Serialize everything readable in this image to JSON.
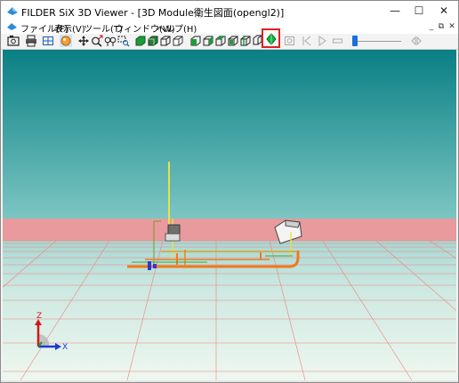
{
  "window": {
    "title": "FILDER SiX 3D Viewer - [3D Module衛生図面(opengl2)]",
    "controls": {
      "minimize": "—",
      "maximize": "☐",
      "close": "✕"
    }
  },
  "menu": {
    "items": [
      {
        "label": "ファイル(F)"
      },
      {
        "label": "表示(V)"
      },
      {
        "label": "ツール(T)"
      },
      {
        "label": "ウィンドウ(W)"
      },
      {
        "label": "ヘルプ(H)"
      }
    ],
    "mdi_controls": {
      "minimize": "_",
      "restore": "⧉",
      "close": "✕"
    }
  },
  "toolbar": {
    "icons": [
      "camera-icon",
      "print-icon",
      "grid-icon",
      "sphere-icon",
      "pan-icon",
      "zoom-in-icon",
      "zoom-out-icon",
      "zoom-window-icon",
      "solid-view-icon",
      "shaded-view-icon",
      "wire-view-icon",
      "hidden-view-icon",
      "front-view-icon",
      "side-view-icon",
      "top-view-icon",
      "iso-view-icon",
      "clip-view-icon",
      "green-diamond-icon",
      "record-icon",
      "first-frame-icon",
      "play-icon",
      "stop-icon",
      "slider",
      "end-frame-icon"
    ],
    "highlighted": "green-diamond-icon"
  },
  "viewport": {
    "sky_top_color": "#0a7f84",
    "sky_bottom_color": "#7cc6c2",
    "wall_color": "#e89a9c",
    "floor_color": "#e6f3ea",
    "grid_color": "#f08080",
    "pipe_color": "#f07a1c",
    "vertical_pipe_color": "#e8e04a",
    "axis": {
      "z_label": "Z",
      "x_label": "X",
      "z_color": "#d01818",
      "x_color": "#1a3ad8",
      "y_color": "#10a020"
    }
  }
}
